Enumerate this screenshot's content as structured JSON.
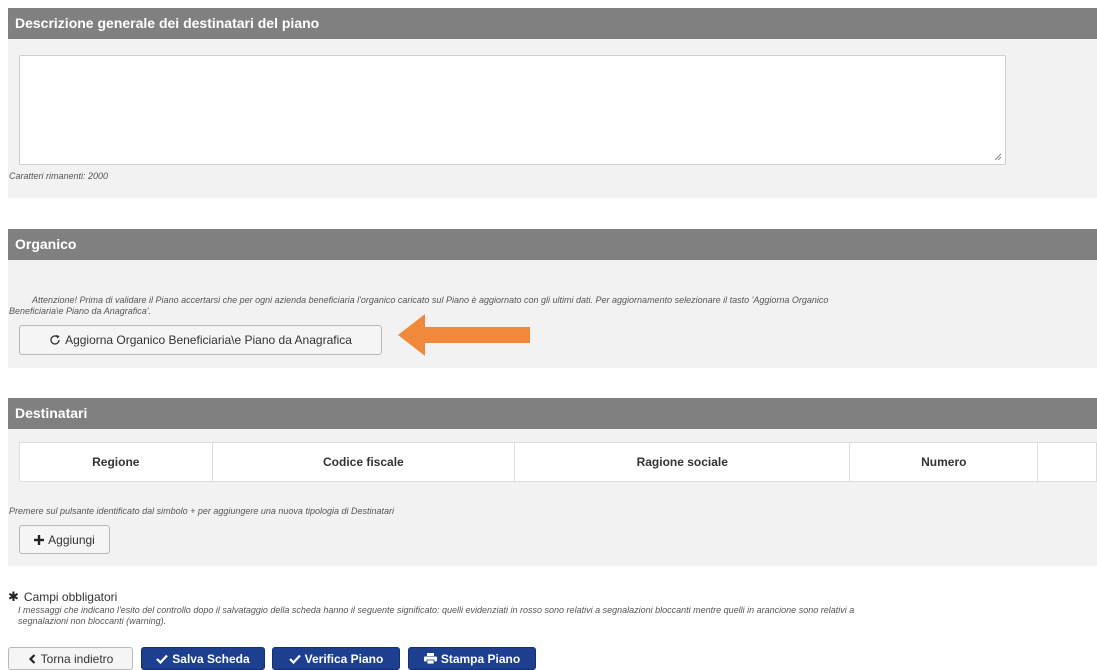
{
  "desc_panel": {
    "title": "Descrizione generale dei destinatari del piano",
    "textarea_value": "",
    "remaining_chars": "Caratteri rimanenti: 2000"
  },
  "org_panel": {
    "title": "Organico",
    "notice_line1": "Attenzione! Prima di validare il Piano accertarsi che per ogni azienda beneficiaria  l'organico caricato sul Piano è aggiornato con gli ultimi dati. Per aggiornamento selezionare il tasto 'Aggiorna Organico",
    "notice_line2": "Beneficiaria\\e Piano da Anagrafica'.",
    "update_button_label": "Aggiorna Organico Beneficiaria\\e Piano da Anagrafica",
    "arrow_color": "#f0893c"
  },
  "dest_panel": {
    "title": "Destinatari",
    "columns": [
      "Regione",
      "Codice fiscale",
      "Ragione sociale",
      "Numero",
      ""
    ],
    "add_hint": "Premere sul pulsante identificato dal simbolo + per aggiungere una nuova tipologia di Destinatari",
    "add_button_label": "Aggiungi"
  },
  "footer": {
    "required_label": "Campi obbligatori",
    "messages_note_line1": "I messaggi che indicano l'esito del controllo dopo il salvataggio della scheda hanno il seguente significato: quelli evidenziati in rosso sono relativi a segnalazioni bloccanti mentre quelli in arancione sono relativi a",
    "messages_note_line2": "segnalazioni non bloccanti (warning).",
    "back_label": "Torna indietro",
    "save_label": "Salva Scheda",
    "verify_label": "Verifica Piano",
    "print_label": "Stampa Piano"
  },
  "colors": {
    "header_bg": "#808080",
    "panel_bg": "#f2f2f2",
    "primary": "#1c3f8f"
  }
}
